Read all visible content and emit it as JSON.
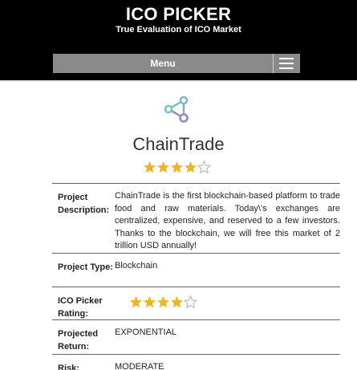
{
  "header": {
    "title": "ICO PICKER",
    "tagline": "True Evaluation of ICO Market",
    "menu_label": "Menu"
  },
  "project": {
    "name": "ChainTrade",
    "rating": 4,
    "rating_max": 5
  },
  "details": [
    {
      "label": "Project Description:",
      "value": "ChainTrade is the first blockchain-based platform to trade food and raw materials. Today\\'s exchanges are centralized, expensive, and reserved to a few investors. Thanks to the blockchain, we will free this market of 2 trillion USD annually!"
    },
    {
      "label": "Project Type:",
      "value": "Blockchain"
    },
    {
      "label": "ICO Picker Rating:",
      "rating": 4
    },
    {
      "label": "Projected Return:",
      "value": "EXPONENTIAL"
    },
    {
      "label": "Risk:",
      "value": "MODERATE"
    }
  ],
  "colors": {
    "header_bg": "#000000",
    "menu_bg": "#8a8a8a",
    "star_filled": "#f0b429",
    "star_empty": "#bbbbbb",
    "logo_teal": "#6fc3c0",
    "logo_purple": "#9b8cc4"
  },
  "icons": {
    "menu": "hamburger-icon",
    "logo": "share-nodes-icon",
    "star": "star-icon"
  }
}
